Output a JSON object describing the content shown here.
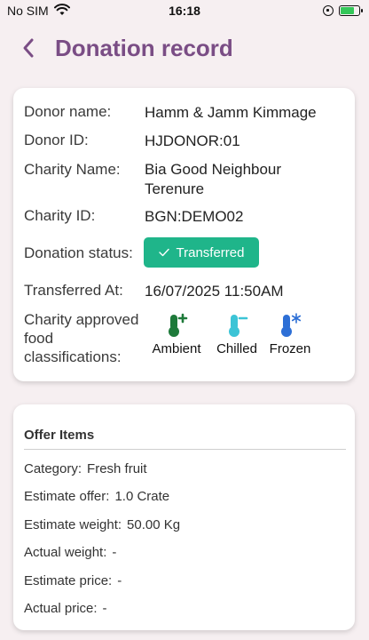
{
  "statusbar": {
    "carrier": "No SIM",
    "time": "16:18"
  },
  "header": {
    "title": "Donation record",
    "back_icon": "chevron-left-icon",
    "accent": "#7a4d85"
  },
  "record": {
    "donor_name_label": "Donor name:",
    "donor_name": "Hamm & Jamm Kimmage",
    "donor_id_label": "Donor ID:",
    "donor_id": "HJDONOR:01",
    "charity_name_label": "Charity Name:",
    "charity_name_line1": "Bia Good Neighbour",
    "charity_name_line2": "Terenure",
    "charity_id_label": "Charity ID:",
    "charity_id": "BGN:DEMO02",
    "status_label": "Donation status:",
    "status": "Transferred",
    "status_color": "#1fb58a",
    "transferred_at_label": "Transferred At:",
    "transferred_at": "16/07/2025 11:50AM",
    "classifications_label_line1": "Charity approved",
    "classifications_label_line2": "food",
    "classifications_label_line3": "classifications:",
    "classifications": [
      {
        "label": "Ambient",
        "icon": "thermometer-plus-icon",
        "color": "#1e7a3a"
      },
      {
        "label": "Chilled",
        "icon": "thermometer-minus-icon",
        "color": "#3cc4d6"
      },
      {
        "label": "Frozen",
        "icon": "thermometer-snowflake-icon",
        "color": "#2d6fd6"
      }
    ]
  },
  "offer": {
    "title": "Offer Items",
    "category_label": "Category:",
    "category": "Fresh fruit",
    "estimate_offer_label": "Estimate offer:",
    "estimate_offer": "1.0 Crate",
    "estimate_weight_label": "Estimate weight:",
    "estimate_weight": "50.00 Kg",
    "actual_weight_label": "Actual weight:",
    "actual_weight": "-",
    "estimate_price_label": "Estimate price:",
    "estimate_price": "-",
    "actual_price_label": "Actual price:",
    "actual_price": "-"
  }
}
